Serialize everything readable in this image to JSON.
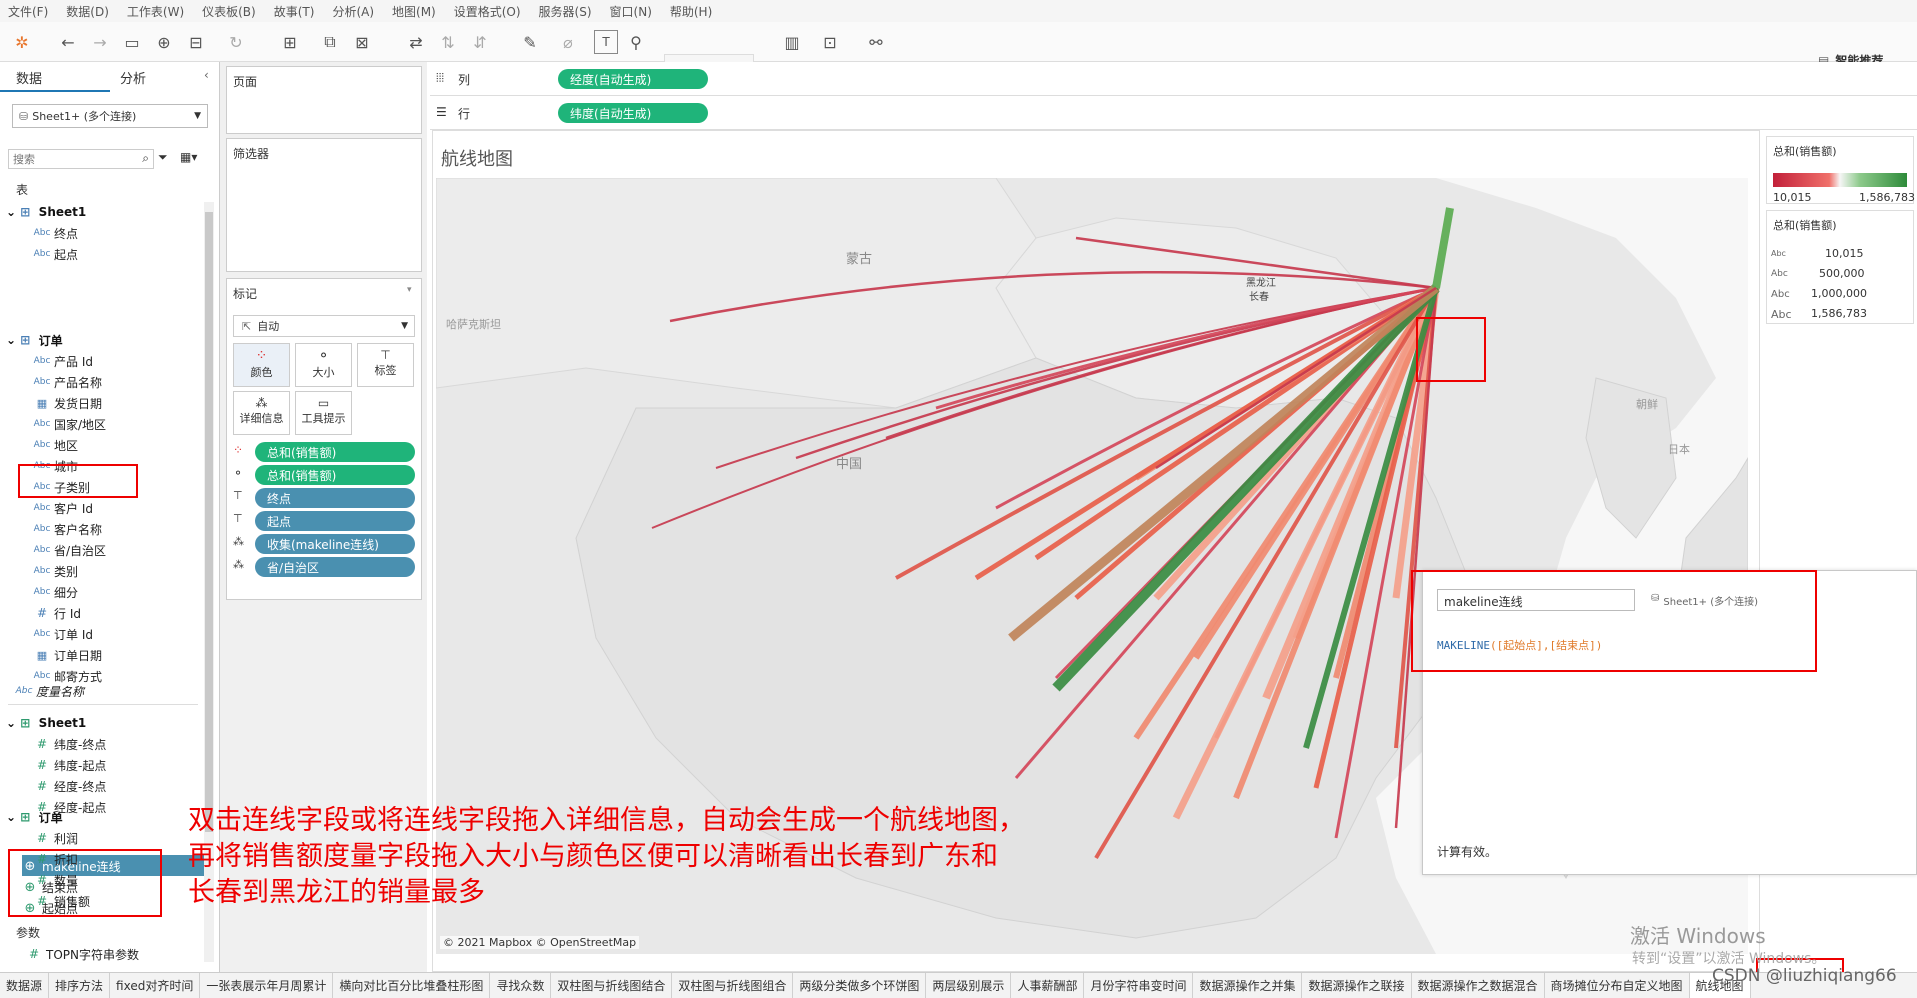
{
  "menu": [
    "文件(F)",
    "数据(D)",
    "工作表(W)",
    "仪表板(B)",
    "故事(T)",
    "分析(A)",
    "地图(M)",
    "设置格式(O)",
    "服务器(S)",
    "窗口(N)",
    "帮助(H)"
  ],
  "toolbar": {
    "smart_label": "智能推荐"
  },
  "left": {
    "tab_data": "数据",
    "tab_analysis": "分析",
    "datasource": "Sheet1+ (多个连接)",
    "search_placeholder": "搜索",
    "table_label": "表",
    "groups": [
      {
        "name": "Sheet1",
        "fields": [
          {
            "icon": "Abc",
            "name": "终点"
          },
          {
            "icon": "Abc",
            "name": "起点"
          }
        ]
      },
      {
        "name": "订单",
        "fields": [
          {
            "icon": "Abc",
            "name": "产品 Id"
          },
          {
            "icon": "Abc",
            "name": "产品名称"
          },
          {
            "icon": "date",
            "name": "发货日期"
          },
          {
            "icon": "Abc",
            "name": "国家/地区"
          },
          {
            "icon": "Abc",
            "name": "地区"
          },
          {
            "icon": "Abc",
            "name": "城市"
          },
          {
            "icon": "Abc",
            "name": "子类别"
          },
          {
            "icon": "Abc",
            "name": "客户 Id"
          },
          {
            "icon": "Abc",
            "name": "客户名称"
          },
          {
            "icon": "Abc",
            "name": "省/自治区"
          },
          {
            "icon": "Abc",
            "name": "类别"
          },
          {
            "icon": "Abc",
            "name": "细分"
          },
          {
            "icon": "#",
            "name": "行 Id"
          },
          {
            "icon": "Abc",
            "name": "订单 Id"
          },
          {
            "icon": "date",
            "name": "订单日期"
          },
          {
            "icon": "Abc",
            "name": "邮寄方式"
          }
        ]
      }
    ],
    "measure_names": "度量名称",
    "measure_groups": [
      {
        "name": "Sheet1",
        "fields": [
          {
            "name": "纬度-终点"
          },
          {
            "name": "纬度-起点"
          },
          {
            "name": "经度-终点"
          },
          {
            "name": "经度-起点"
          }
        ]
      },
      {
        "name": "订单",
        "fields": [
          {
            "name": "利润"
          },
          {
            "name": "折扣"
          },
          {
            "name": "数量"
          },
          {
            "name": "销售额"
          }
        ]
      }
    ],
    "spatial_fields": [
      "makeline连线",
      "结束点",
      "起始点"
    ],
    "params_label": "参数",
    "param": "TOPN字符串参数"
  },
  "mid": {
    "pages": "页面",
    "filters": "筛选器",
    "marks": "标记",
    "mark_type": "自动",
    "mark_cards": [
      "颜色",
      "大小",
      "标签",
      "详细信息",
      "工具提示"
    ],
    "mark_pills": [
      "总和(销售额)",
      "总和(销售额)",
      "终点",
      "起点",
      "收集(makeline连线)",
      "省/自治区"
    ]
  },
  "shelves": {
    "cols_label": "列",
    "cols_pill": "经度(自动生成)",
    "rows_label": "行",
    "rows_pill": "纬度(自动生成)"
  },
  "view": {
    "title": "航线地图",
    "map_labels": {
      "mongolia": "蒙古",
      "china": "中国",
      "japan": "日本",
      "korea": "朝鲜",
      "heilongjiang": "黑龙江",
      "changchun": "长春",
      "kazakh": "哈萨克斯坦"
    },
    "attribution": "© 2021 Mapbox © OpenStreetMap"
  },
  "legend": {
    "color_title": "总和(销售额)",
    "color_min": "10,015",
    "color_max": "1,586,783",
    "size_title": "总和(销售额)",
    "size_items": [
      "10,015",
      "500,000",
      "1,000,000",
      "1,586,783"
    ]
  },
  "calc": {
    "name": "makeline连线",
    "source": "Sheet1+ (多个连接)",
    "formula_fn": "MAKELINE",
    "formula_args": "([起始点],[结束点])",
    "status": "计算有效。"
  },
  "annotation": [
    "双击连线字段或将连线字段拖入详细信息，自动会生成一个航线地图，",
    "再将销售额度量字段拖入大小与颜色区便可以清晰看出长春到广东和",
    "长春到黑龙江的销量最多"
  ],
  "watermark": {
    "line1": "激活 Windows",
    "line2": "转到“设置”以激活 Windows。",
    "csdn": "CSDN @liuzhiqiang66"
  },
  "bottom_tabs": [
    "数据源",
    "排序方法",
    "fixed对齐时间",
    "一张表展示年月周累计",
    "横向对比百分比堆叠柱形图",
    "寻找众数",
    "双柱图与折线图结合",
    "双柱图与折线图组合",
    "两级分类做多个环饼图",
    "两层级别展示",
    "人事薪酬部",
    "月份字符串变时间",
    "数据源操作之并集",
    "数据源操作之联接",
    "数据源操作之数据混合",
    "商场摊位分布自定义地图",
    "航线地图"
  ],
  "colors": {
    "dim": "#4a90b0",
    "measure": "#1fb47a",
    "red": "#e00000"
  }
}
